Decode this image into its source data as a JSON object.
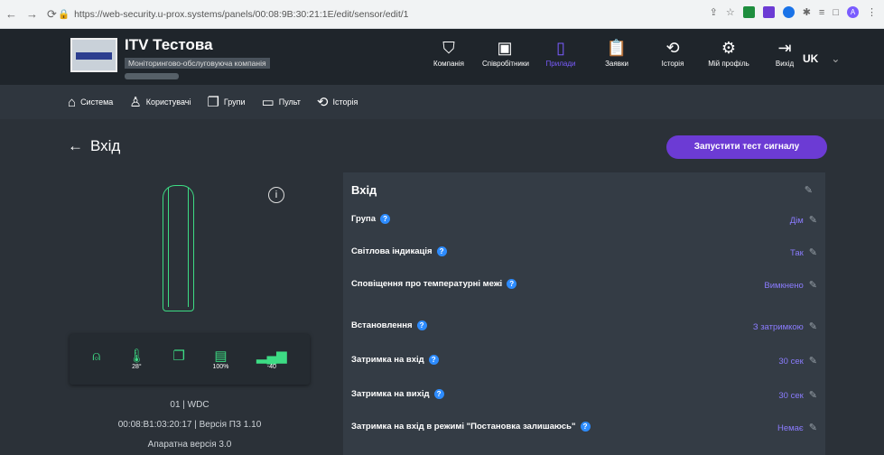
{
  "browser": {
    "url": "https://web-security.u-prox.systems/panels/00:08:9B:30:21:1E/edit/sensor/edit/1",
    "profile_initial": "A"
  },
  "company": {
    "name": "ITV Тестова",
    "type": "Моніторингово-обслуговуюча компанія"
  },
  "main_nav": [
    {
      "label": "Компанія",
      "icon": "shield-icon"
    },
    {
      "label": "Співробітники",
      "icon": "id-card-icon"
    },
    {
      "label": "Прилади",
      "icon": "device-icon"
    },
    {
      "label": "Заявки",
      "icon": "clipboard-icon"
    },
    {
      "label": "Історія",
      "icon": "history-icon"
    },
    {
      "label": "Мій профіль",
      "icon": "user-gear-icon"
    },
    {
      "label": "Вихід",
      "icon": "logout-icon"
    }
  ],
  "language": "UK",
  "sub_nav": [
    {
      "label": "Система",
      "icon": "home-icon"
    },
    {
      "label": "Користувачі",
      "icon": "user-icon"
    },
    {
      "label": "Групи",
      "icon": "groups-icon"
    },
    {
      "label": "Пульт",
      "icon": "monitor-icon"
    },
    {
      "label": "Історія",
      "icon": "history-icon"
    }
  ],
  "page": {
    "back_title": "Вхід",
    "test_button": "Запустити тест сигналу"
  },
  "device_status": [
    {
      "icon": "alarm-bell-icon",
      "value": ""
    },
    {
      "icon": "thermometer-icon",
      "value": "28°"
    },
    {
      "icon": "tamper-icon",
      "value": ""
    },
    {
      "icon": "battery-icon",
      "value": "100%"
    },
    {
      "icon": "signal-icon",
      "value": "-40"
    }
  ],
  "device_info": {
    "line1": "01 | WDC",
    "line2": "00:08:B1:03:20:17 | Версія ПЗ 1.10",
    "line3": "Апаратна версія 3.0"
  },
  "panel": {
    "title": "Вхід",
    "rows": [
      {
        "label": "Група",
        "value": "Дім",
        "help": true
      },
      {
        "label": "Світлова індикація",
        "value": "Так",
        "help": true
      },
      {
        "label": "Сповіщення про температурні межі",
        "value": "Вимкнено",
        "help": true
      },
      {
        "label": "Встановлення",
        "value": "З затримкою",
        "help": true
      },
      {
        "label": "Затримка на вхід",
        "value": "30 сек",
        "help": true
      },
      {
        "label": "Затримка на вихід",
        "value": "30 сек",
        "help": true
      },
      {
        "label": "Затримка на вхід в режимі \"Постановка залишаюсь\"",
        "value": "Немає",
        "help": true
      }
    ]
  },
  "colors": {
    "accent": "#6c3bd4",
    "value_text": "#8b7cff",
    "sensor_green": "#3ddc84"
  }
}
